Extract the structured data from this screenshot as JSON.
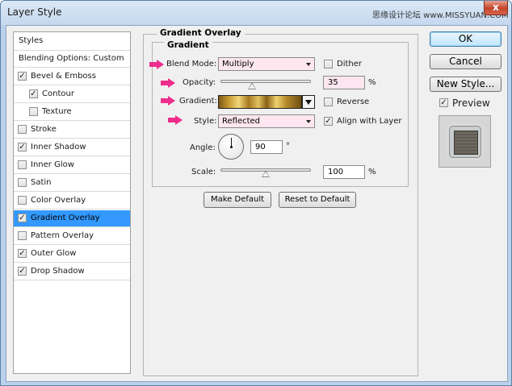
{
  "window": {
    "title": "Layer Style",
    "watermark": "思缘设计论坛 www.MISSYUAN.COM",
    "close_glyph": "x"
  },
  "style_list": {
    "header": "Styles",
    "blending": "Blending Options: Custom",
    "items": [
      {
        "label": "Bevel & Emboss",
        "checked": true
      },
      {
        "label": "Contour",
        "checked": true
      },
      {
        "label": "Texture",
        "checked": false
      },
      {
        "label": "Stroke",
        "checked": false
      },
      {
        "label": "Inner Shadow",
        "checked": true
      },
      {
        "label": "Inner Glow",
        "checked": false
      },
      {
        "label": "Satin",
        "checked": false
      },
      {
        "label": "Color Overlay",
        "checked": false
      },
      {
        "label": "Gradient Overlay",
        "checked": true,
        "selected": true
      },
      {
        "label": "Pattern Overlay",
        "checked": false
      },
      {
        "label": "Outer Glow",
        "checked": true
      },
      {
        "label": "Drop Shadow",
        "checked": true
      }
    ]
  },
  "panel": {
    "title": "Gradient Overlay",
    "subtitle": "Gradient",
    "blend_mode": {
      "label": "Blend Mode:",
      "value": "Multiply"
    },
    "dither": {
      "label": "Dither",
      "checked": false
    },
    "opacity": {
      "label": "Opacity:",
      "value": "35",
      "unit": "%",
      "level": 0.35
    },
    "gradient": {
      "label": "Gradient:"
    },
    "reverse": {
      "label": "Reverse",
      "checked": false
    },
    "style": {
      "label": "Style:",
      "value": "Reflected"
    },
    "align": {
      "label": "Align with Layer",
      "checked": true
    },
    "angle": {
      "label": "Angle:",
      "value": "90",
      "unit": "°"
    },
    "scale": {
      "label": "Scale:",
      "value": "100",
      "unit": "%",
      "level": 0.5
    },
    "make_default": "Make Default",
    "reset_default": "Reset to Default"
  },
  "actions": {
    "ok": "OK",
    "cancel": "Cancel",
    "new_style": "New Style...",
    "preview": {
      "label": "Preview",
      "checked": true
    }
  },
  "colors": {
    "selection": "#3399ff",
    "highlight_arrow": "#ee2d8c",
    "field_tint": "#fde6ef"
  },
  "check_glyph": "✓"
}
